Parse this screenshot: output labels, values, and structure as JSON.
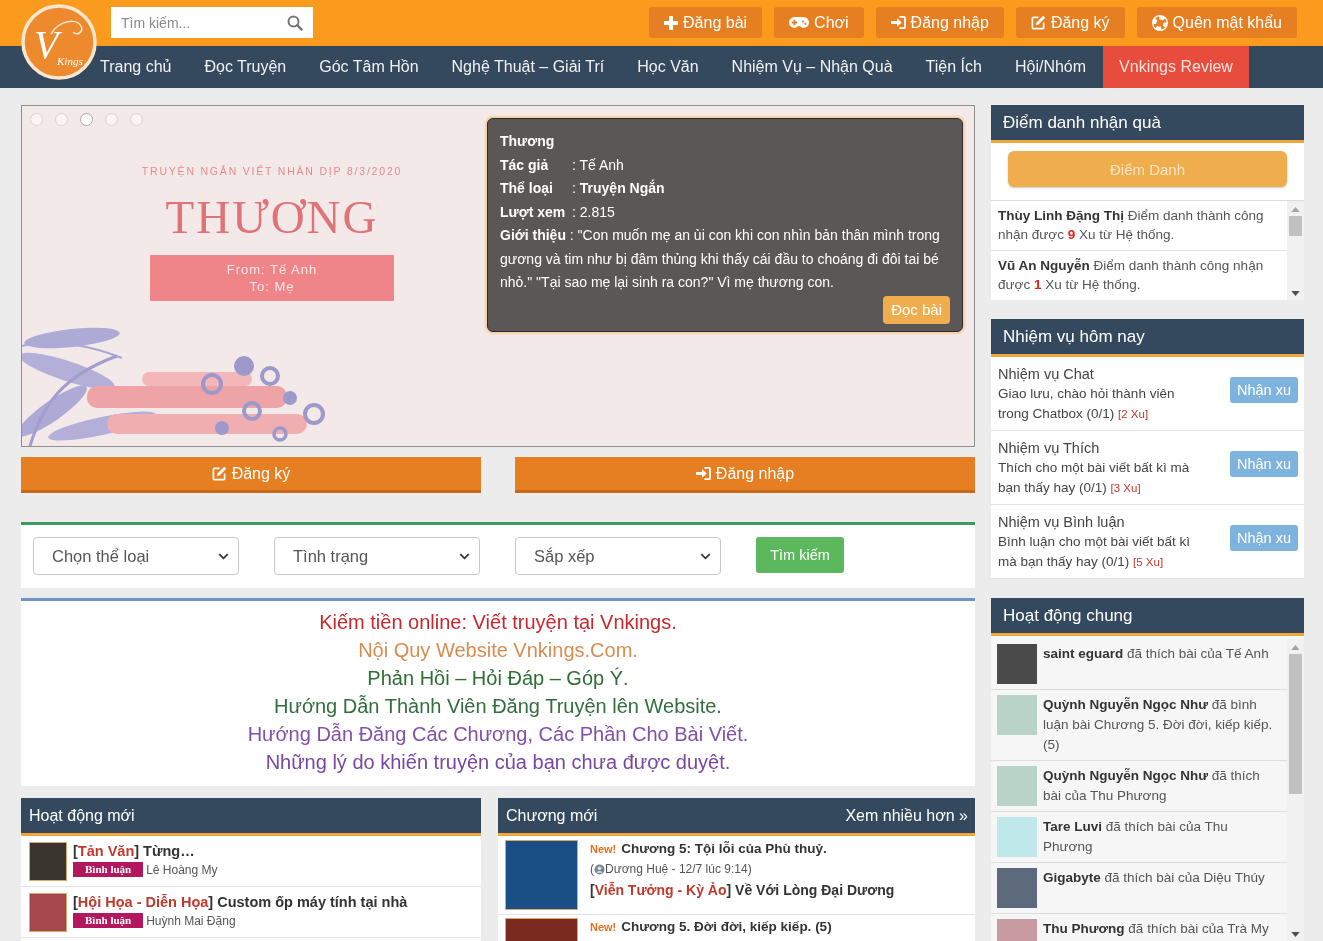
{
  "header": {
    "logo": {
      "mark": "V",
      "name": "Kings"
    },
    "search": {
      "placeholder": "Tìm kiếm..."
    },
    "buttons": [
      {
        "kind": "post",
        "label": "Đăng bài"
      },
      {
        "kind": "play",
        "label": "Chơi"
      },
      {
        "kind": "login",
        "label": "Đăng nhập"
      },
      {
        "kind": "register",
        "label": "Đăng ký"
      },
      {
        "kind": "recover",
        "label": "Quên mật khẩu"
      }
    ]
  },
  "nav": {
    "items": [
      {
        "label": "Trang chủ",
        "highlighted": false
      },
      {
        "label": "Đọc Truyện",
        "highlighted": false
      },
      {
        "label": "Góc Tâm Hồn",
        "highlighted": false
      },
      {
        "label": "Nghệ Thuật – Giải Trí",
        "highlighted": false
      },
      {
        "label": "Học Văn",
        "highlighted": false
      },
      {
        "label": "Nhiệm Vụ – Nhận Quà",
        "highlighted": false
      },
      {
        "label": "Tiện Ích",
        "highlighted": false
      },
      {
        "label": "Hội/Nhóm",
        "highlighted": false
      },
      {
        "label": "Vnkings Review",
        "highlighted": true
      }
    ]
  },
  "banner": {
    "slides": [
      {
        "selected": false
      },
      {
        "selected": false
      },
      {
        "selected": true
      },
      {
        "selected": false
      },
      {
        "selected": false
      }
    ],
    "art": {
      "kicker": "TRUYỆN NGẮN VIẾT NHÂN DỊP 8/3/2020",
      "title": "THƯƠNG",
      "from": "From: Tế Anh",
      "to": "To: Mẹ"
    },
    "info": {
      "title": "Thương",
      "fields": [
        {
          "label": "Tác giả",
          "value": ": Tế Anh"
        },
        {
          "label": "Thể loại",
          "value": ": **Truyện Ngắn**"
        },
        {
          "label": "Lượt xem",
          "value": ": 2.815"
        }
      ],
      "summary": "**Giới thiệu** : \"Con muốn mẹ an ủi con khi con nhìn bản thân mình trong gương và tim như bị đâm thủng khi thấy cái đầu to choáng đi đôi tai bé nhỏ.\" \"Tại sao mẹ lại sinh ra con?\" Vì mẹ thương con.",
      "button": "Đọc bài"
    }
  },
  "actions": [
    {
      "kind": "register",
      "label": "Đăng ký"
    },
    {
      "kind": "login",
      "label": "Đăng nhập"
    }
  ],
  "filters": {
    "selects": [
      {
        "value": "Chọn thể loại"
      },
      {
        "value": "Tình trạng"
      },
      {
        "value": "Sắp xếp"
      }
    ],
    "button": "Tìm kiếm"
  },
  "links": [
    {
      "text": "Kiếm tiền online: Viết truyện tại Vnkings.",
      "color": "#c8282d"
    },
    {
      "text": "Nội Quy Website Vnkings.Com.",
      "color": "#d98c50"
    },
    {
      "text": "Phản Hồi – Hỏi Đáp – Góp Ý.",
      "color": "#2d6e32"
    },
    {
      "text": "Hướng Dẫn Thành Viên Đăng Truyện lên Website.",
      "color": "#326e3c"
    },
    {
      "text": "Hướng Dẫn Đăng Các Chương, Các Phần Cho Bài Viết.",
      "color": "#8250aa"
    },
    {
      "text": "Những lý do khiến truyện của bạn chưa được duyệt.",
      "color": "#7846a0"
    }
  ],
  "recent_activity": {
    "title": "Hoạt động mới",
    "items": [
      {
        "lead": "[",
        "category": "Tản Văn",
        "rest": "] Từng…",
        "badge": "Bình luận",
        "author": "Lê Hoàng My"
      },
      {
        "lead": "[",
        "category": "Hội Họa - Diễn Họa",
        "rest": "] Custom ốp máy tính tại nhà",
        "badge": "Bình luận",
        "author": "Huỳnh Mai Đặng"
      }
    ]
  },
  "new_chapters": {
    "title": "Chương mới",
    "more": "Xem nhiều hơn »",
    "items": [
      {
        "flag": "New!",
        "title": "Chương 5: Tội lỗi của Phù thuỷ.",
        "meta_open": "(",
        "meta": "Dương Huệ - 12/7 lúc 9:14)",
        "lead": "[",
        "category": "Viễn Tưởng - Kỳ Ảo",
        "rest": "] Về Với Lòng Đại Dương"
      },
      {
        "flag": "New!",
        "title": "Chương 5. Đời đời, kiếp kiếp. (5)"
      }
    ]
  },
  "checkin": {
    "title": "Điểm danh nhận quà",
    "button": "Điểm Danh",
    "entries": [
      "**Thùy Linh Đặng Thị** Điểm danh thành công nhận được **9** Xu từ Hệ thống.",
      "**Vũ An Nguyễn** Điểm danh thành công nhận được **1** Xu từ Hệ thống."
    ]
  },
  "tasks": {
    "title": "Nhiệm vụ hôm nay",
    "items": [
      {
        "name": "Nhiệm vụ Chat",
        "description": "Giao lưu, chào hỏi thành viên trong Chatbox (0/1)",
        "reward": "[2 Xu]",
        "button": "Nhận xu"
      },
      {
        "name": "Nhiệm vụ Thích",
        "description": "Thích cho một bài viết bất kì mà bạn thấy hay (0/1)",
        "reward": "[3 Xu]",
        "button": "Nhận xu"
      },
      {
        "name": "Nhiệm vụ Bình luận",
        "description": "Bình luận cho một bài viết bất kì mà bạn thấy hay (0/1)",
        "reward": "[5 Xu]",
        "button": "Nhận xu"
      }
    ]
  },
  "community": {
    "title": "Hoạt động chung",
    "items": [
      "**saint eguard** đã thích bài của Tế Anh",
      "**Quỳnh Nguyễn Ngọc Như** đã bình luận bài Chương 5. Đời đời, kiếp kiếp. (5)",
      "**Quỳnh Nguyễn Ngọc Như** đã thích bài của Thu Phương",
      "**Tare Luvi** đã thích bài của Thu Phương",
      "**Gigabyte** đã thích bài của Diệu Thúy",
      "**Thu Phương** đã thích bài của Trà My"
    ]
  }
}
